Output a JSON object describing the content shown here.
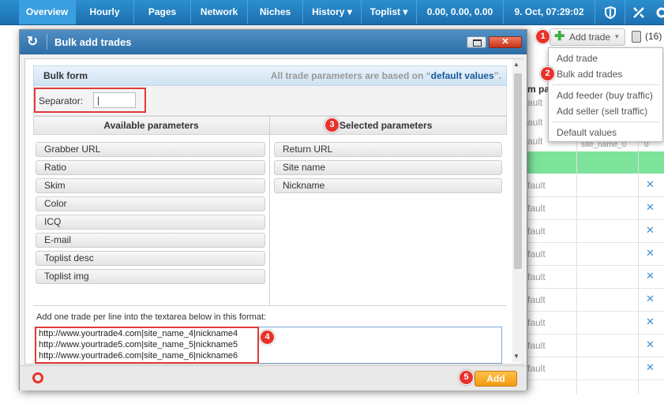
{
  "nav": {
    "items": [
      "Overview",
      "Hourly",
      "Pages",
      "Network",
      "Niches",
      "History ▾",
      "Toplist ▾"
    ],
    "stats": "0.00, 0.00, 0.00",
    "datetime": "9. Oct,  07:29:02"
  },
  "toolbar": {
    "add_trade_label": "Add trade",
    "count_label": "(16)"
  },
  "dropdown": {
    "items": [
      "Add trade",
      "Bulk add trades",
      "Add feeder (buy traffic)",
      "Add seller (sell traffic)",
      "Default values"
    ]
  },
  "modal": {
    "title": "Bulk add trades",
    "form_title": "Bulk form",
    "hint_prefix": "All trade parameters are based on “",
    "hint_link": "default values",
    "hint_suffix": "”.",
    "separator_label": "Separator:",
    "separator_value": "|",
    "available_header": "Available parameters",
    "selected_header": "Selected parameters",
    "available_params": [
      "Grabber URL",
      "Ratio",
      "Skim",
      "Color",
      "ICQ",
      "E-mail",
      "Toplist desc",
      "Toplist img"
    ],
    "selected_params": [
      "Return URL",
      "Site name",
      "Nickname"
    ],
    "instructions": "Add one trade per line into the textarea below in this format:",
    "textarea_lines": [
      "http://www.yourtrade4.com|site_name_4|nickname4",
      "http://www.yourtrade5.com|site_name_5|nickname5",
      "http://www.yourtrade6.com|site_name_6|nickname6"
    ],
    "add_button": "Add"
  },
  "badges": [
    "1",
    "2",
    "3",
    "4",
    "5"
  ],
  "background": {
    "partial_header": "m pa",
    "cell_text": "ault",
    "cell_text_alt": "fault",
    "sub_label": "site_name_0",
    "zero": "0"
  },
  "colors": {
    "nav_blue": "#1c6fb0",
    "title_blue": "#2d6ea8",
    "badge_red": "#e8322a",
    "green_row": "#7de39b",
    "add_orange": "#f39c12"
  }
}
